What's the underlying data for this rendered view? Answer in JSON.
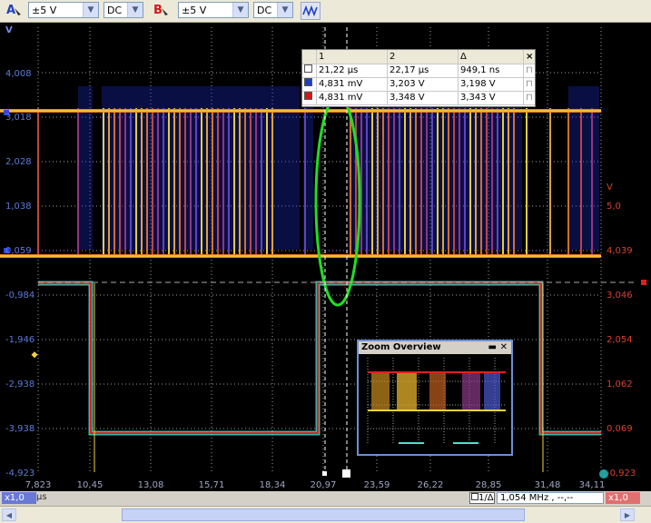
{
  "toolbar": {
    "channel_a": {
      "letter": "A",
      "range": "±5 V",
      "coupling": "DC",
      "color": "#1f3fbf"
    },
    "channel_b": {
      "letter": "B",
      "range": "±5 V",
      "coupling": "DC",
      "color": "#d01818"
    },
    "dropdown_icon": "chevron-down-icon",
    "probe_icon": "waveform-icon"
  },
  "scope": {
    "y_axis_a_unit": "V",
    "y_axis_a_ticks": [
      "4,008",
      "3,018",
      "2,028",
      "1,038",
      "0,059",
      "-0,984",
      "-1,946",
      "-2,938",
      "-3,938",
      "-4,923"
    ],
    "y_axis_b_unit": "V",
    "y_axis_b_ticks": [
      "5,0",
      "4,039",
      "3,046",
      "2,054",
      "1,062",
      "0,069",
      "-0,923"
    ],
    "x_axis_ticks": [
      "7,823",
      "10,45",
      "13,08",
      "15,71",
      "18,34",
      "20,97",
      "23,59",
      "26,22",
      "28,85",
      "31,48",
      "34,11"
    ],
    "x_axis_unit": "µs",
    "colors": {
      "channel_a": "#f2d33a",
      "channel_b": "#e02020",
      "persist_blue": "#1b2cc0",
      "annotation": "#22dd22",
      "cyan": "#4ee0d0",
      "grid": "#9aa0a8"
    }
  },
  "cursor_table": {
    "headers": [
      "",
      "1",
      "2",
      "Δ"
    ],
    "rows": [
      {
        "label": "",
        "c1": "21,22 µs",
        "c2": "22,17 µs",
        "delta": "949,1 ns",
        "swatch": "#ffffff"
      },
      {
        "label": "",
        "c1": "4,831 mV",
        "c2": "3,203 V",
        "delta": "3,198 V",
        "swatch": "#1f3fbf"
      },
      {
        "label": "",
        "c1": "4,831 mV",
        "c2": "3,348 V",
        "delta": "3,343 V",
        "swatch": "#d01818"
      }
    ],
    "close_icon": "close-icon",
    "lock_icon": "lock-icon"
  },
  "zoom_overview": {
    "title": "Zoom Overview",
    "minimize_icon": "minimize-icon",
    "close_icon": "close-icon"
  },
  "bottom_bar": {
    "scale_a": "x1,0",
    "unit": "µs",
    "rule_label": "1/Δ",
    "frequency": "1,054 MHz , --,--",
    "scale_b": "x1,0"
  }
}
